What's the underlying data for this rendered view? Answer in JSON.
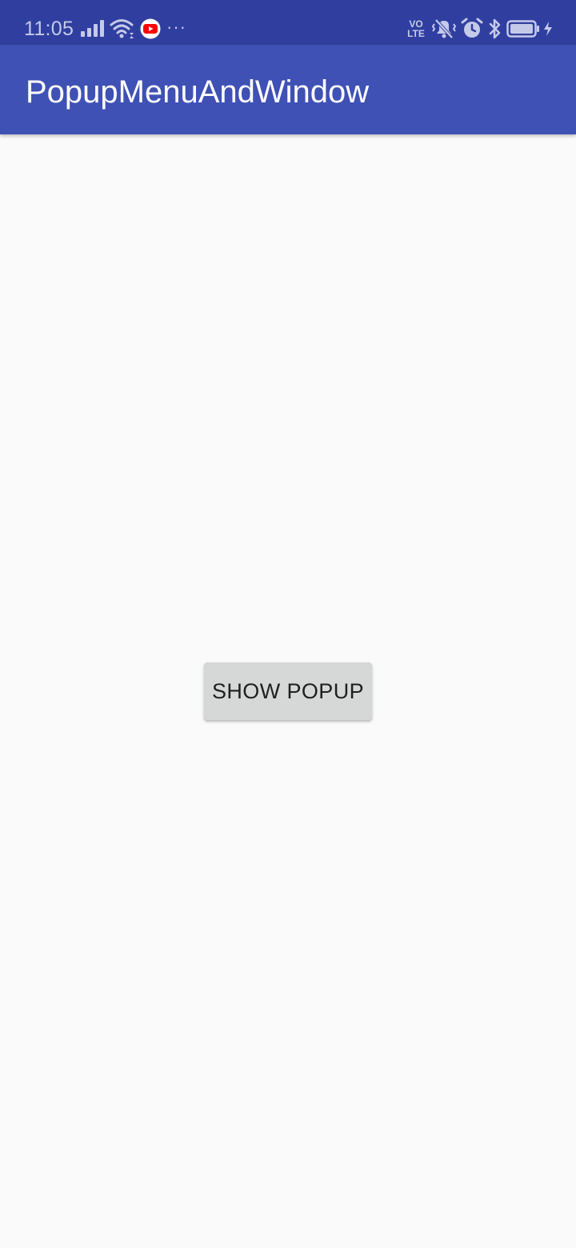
{
  "status_bar": {
    "time": "11:05",
    "more_indicator": "···",
    "volte": {
      "line1": "VO",
      "line2": "LTE"
    },
    "icons": [
      "signal-icon",
      "wifi-icon",
      "youtube-notification-icon",
      "volte-icon",
      "vibrate-icon",
      "alarm-icon",
      "bluetooth-icon",
      "battery-icon",
      "charging-icon"
    ],
    "colors": {
      "background": "#303f9f",
      "foreground": "#c5cae9",
      "youtube_red": "#ff0000"
    }
  },
  "app_bar": {
    "title": "PopupMenuAndWindow",
    "color": "#3f51b5"
  },
  "main": {
    "button_label": "SHOW POPUP",
    "button_color": "#d6d7d7",
    "background": "#fafafa"
  }
}
